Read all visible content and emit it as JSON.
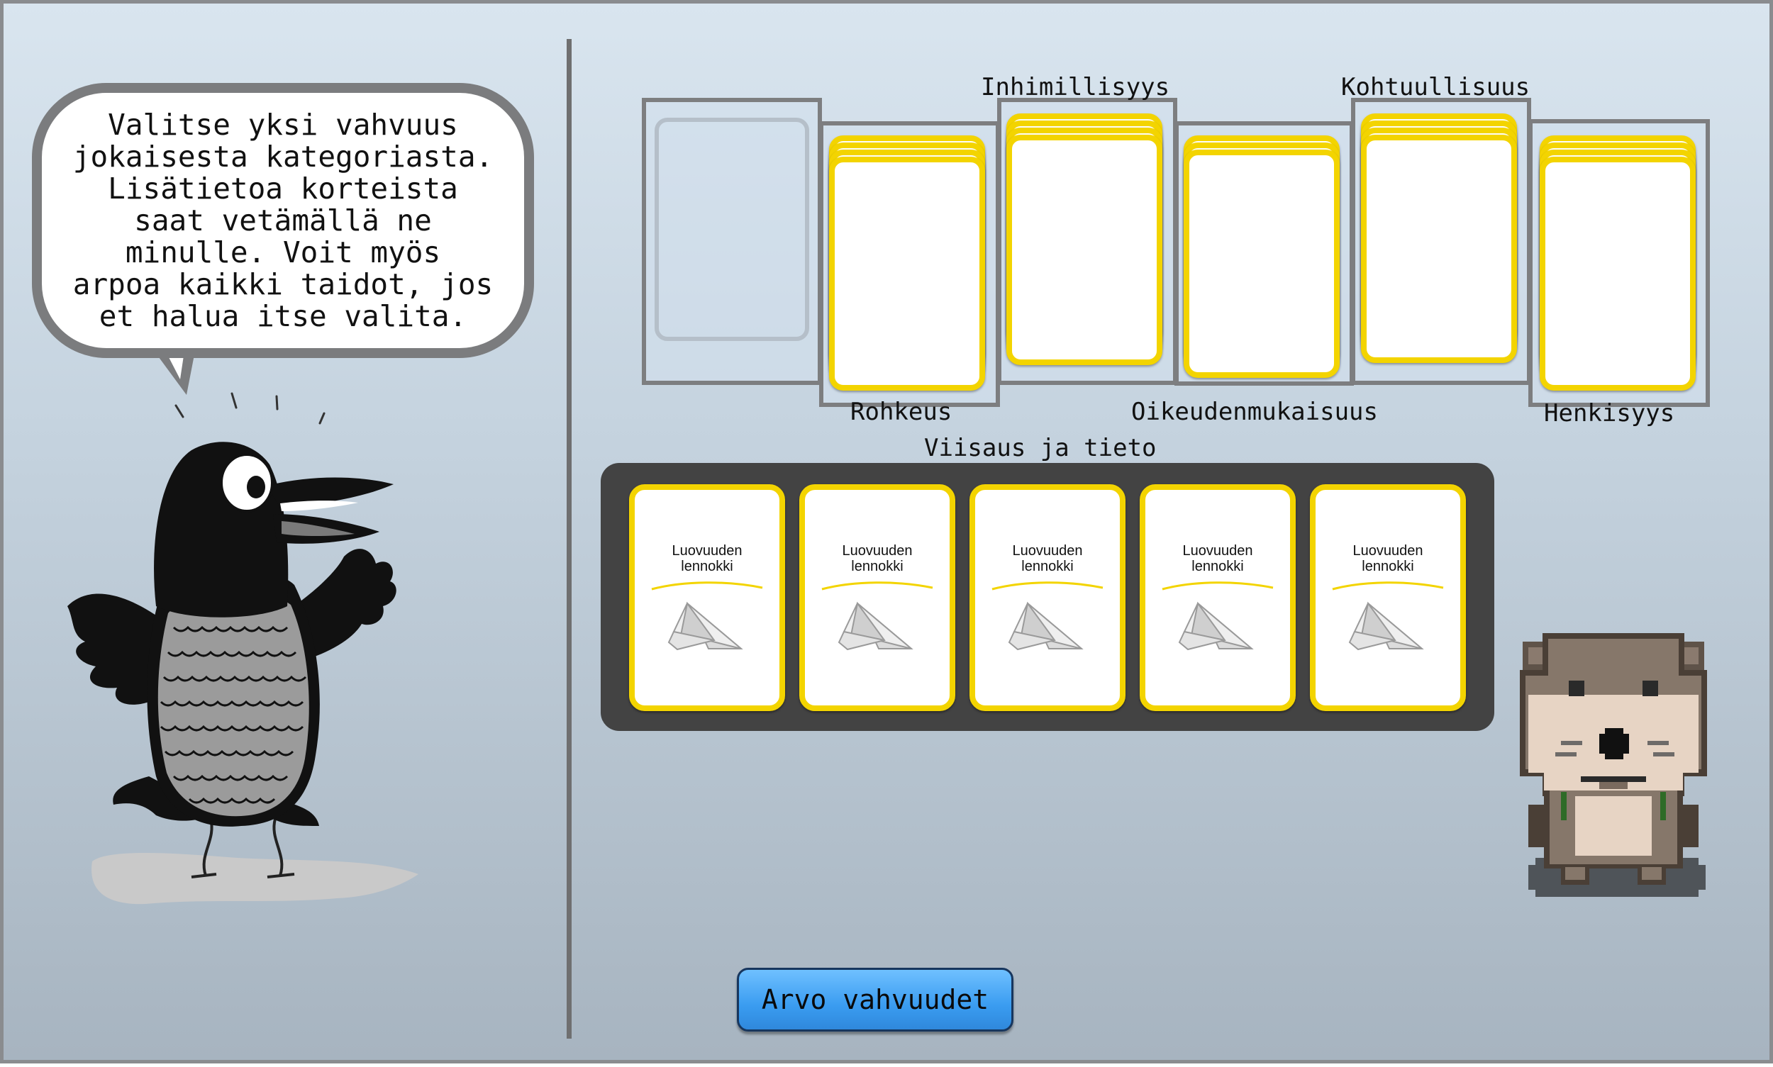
{
  "speech_bubble": {
    "text": "Valitse yksi vahvuus\njokaisesta kategoriasta.\nLisätietoa korteista\nsaat vetämällä ne\nminulle. Voit myös\narpoa kaikki taidot, jos\net halua itse valita."
  },
  "categories": {
    "rohkeus": "Rohkeus",
    "inhimillisyys": "Inhimillisyys",
    "oikeudenmukaisuus": "Oikeudenmukaisuus",
    "kohtuullisuus": "Kohtuullisuus",
    "henkisyys": "Henkisyys",
    "viisaus": "Viisaus ja tieto"
  },
  "hand_cards": [
    {
      "title": "Luovuuden\nlennokki",
      "icon": "paper-plane-icon"
    },
    {
      "title": "Luovuuden\nlennokki",
      "icon": "paper-plane-icon"
    },
    {
      "title": "Luovuuden\nlennokki",
      "icon": "paper-plane-icon"
    },
    {
      "title": "Luovuuden\nlennokki",
      "icon": "paper-plane-icon"
    },
    {
      "title": "Luovuuden\nlennokki",
      "icon": "paper-plane-icon"
    }
  ],
  "button": {
    "label": "Arvo vahvuudet"
  },
  "colors": {
    "card_border": "#f3d400",
    "button": "#3a9cf0",
    "hand_panel": "#434343"
  }
}
